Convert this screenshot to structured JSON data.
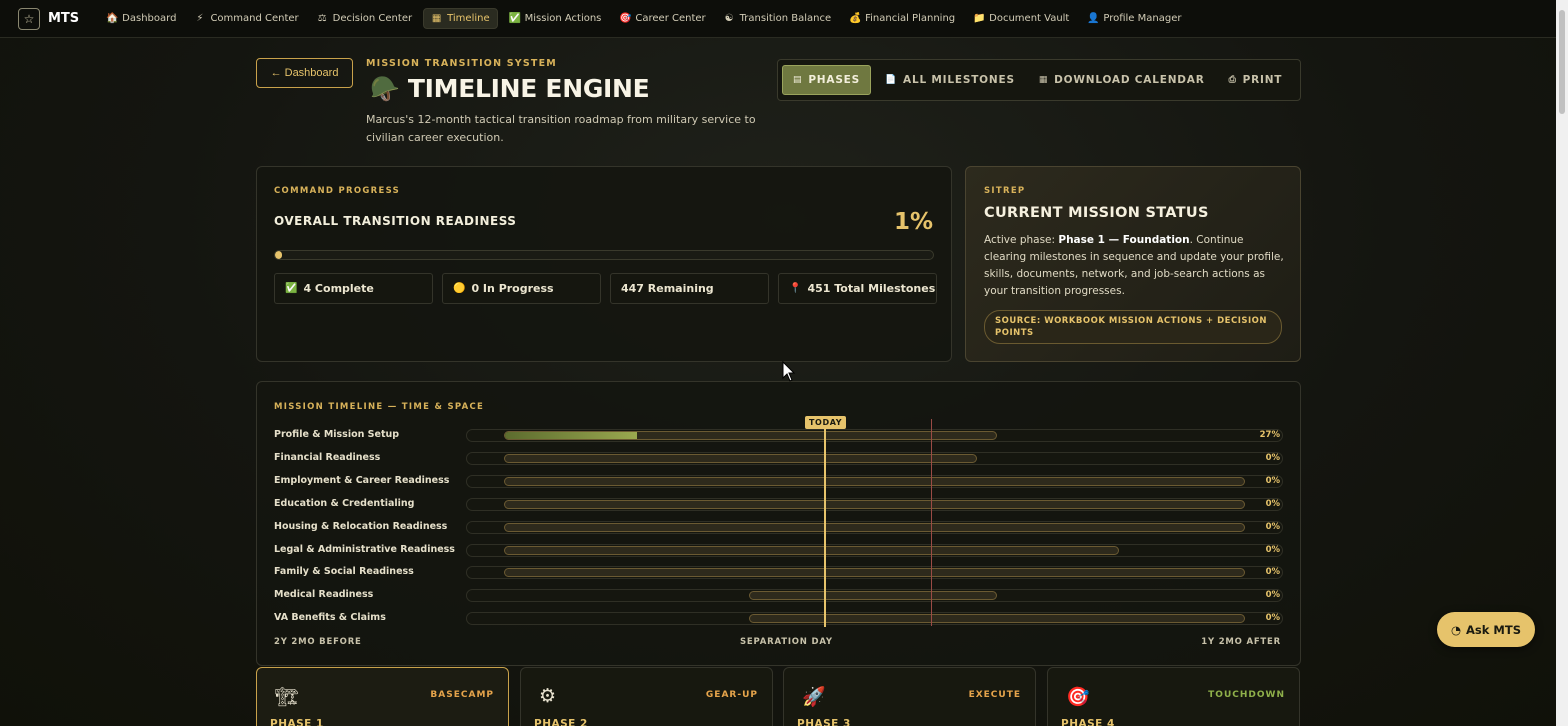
{
  "nav": {
    "logo_icon": "☆",
    "logo_text": "MTS",
    "items": [
      {
        "icon": "🏠",
        "label": "Dashboard",
        "icon_name": "home-icon"
      },
      {
        "icon": "⚡",
        "label": "Command Center",
        "icon_name": "bolt-icon"
      },
      {
        "icon": "⚖",
        "label": "Decision Center",
        "icon_name": "scales-icon"
      },
      {
        "icon": "▦",
        "label": "Timeline",
        "icon_name": "calendar-icon",
        "active": true
      },
      {
        "icon": "✅",
        "label": "Mission Actions",
        "icon_name": "check-icon"
      },
      {
        "icon": "🎯",
        "label": "Career Center",
        "icon_name": "target-icon"
      },
      {
        "icon": "☯",
        "label": "Transition Balance",
        "icon_name": "balance-icon"
      },
      {
        "icon": "💰",
        "label": "Financial Planning",
        "icon_name": "money-bag-icon"
      },
      {
        "icon": "📁",
        "label": "Document Vault",
        "icon_name": "folder-icon"
      },
      {
        "icon": "👤",
        "label": "Profile Manager",
        "icon_name": "user-icon"
      }
    ]
  },
  "header": {
    "back_label": "← Dashboard",
    "eyebrow": "MISSION TRANSITION SYSTEM",
    "title_icon": "🪖",
    "title": "TIMELINE ENGINE",
    "subtitle": "Marcus's 12-month tactical transition roadmap from military service to civilian career execution."
  },
  "view_tabs": [
    {
      "icon": "▤",
      "label": "PHASES",
      "active": true,
      "icon_name": "clipboard-icon"
    },
    {
      "icon": "📄",
      "label": "ALL MILESTONES",
      "icon_name": "document-icon"
    },
    {
      "icon": "▦",
      "label": "DOWNLOAD CALENDAR",
      "icon_name": "calendar-icon"
    },
    {
      "icon": "⎙",
      "label": "PRINT",
      "icon_name": "printer-icon"
    }
  ],
  "progress": {
    "label": "COMMAND PROGRESS",
    "title": "OVERALL TRANSITION READINESS",
    "percent_text": "1%",
    "percent_value": 1,
    "stats": [
      {
        "icon": "✅",
        "text": "4 Complete",
        "icon_name": "check-icon"
      },
      {
        "icon": "🟡",
        "text": "0 In Progress",
        "icon_name": "yellow-dot-icon"
      },
      {
        "icon": "",
        "text": "447 Remaining",
        "icon_name": ""
      },
      {
        "icon": "📍",
        "text": "451 Total Milestones",
        "icon_name": "pin-icon"
      }
    ]
  },
  "sitrep": {
    "label": "SITREP",
    "title": "CURRENT MISSION STATUS",
    "body_prefix": "Active phase: ",
    "body_phase": "Phase 1 — Foundation",
    "body_suffix": ". Continue clearing milestones in sequence and update your profile, skills, documents, network, and job-search actions as your transition progresses.",
    "source": "SOURCE: WORKBOOK MISSION ACTIONS + DECISION POINTS"
  },
  "timeline": {
    "label": "MISSION TIMELINE — TIME & SPACE",
    "today_label": "TODAY",
    "axis_left": "2Y 2MO BEFORE",
    "axis_center": "SEPARATION DAY",
    "axis_right": "1Y 2MO AFTER",
    "rows": [
      {
        "name": "Profile & Mission Setup",
        "pct": "27%",
        "start": 0.046,
        "end": 0.65,
        "progress": 0.27
      },
      {
        "name": "Financial Readiness",
        "pct": "0%",
        "start": 0.046,
        "end": 0.625,
        "progress": 0
      },
      {
        "name": "Employment & Career Readiness",
        "pct": "0%",
        "start": 0.046,
        "end": 0.953,
        "progress": 0
      },
      {
        "name": "Education & Credentialing",
        "pct": "0%",
        "start": 0.046,
        "end": 0.953,
        "progress": 0
      },
      {
        "name": "Housing & Relocation Readiness",
        "pct": "0%",
        "start": 0.046,
        "end": 0.953,
        "progress": 0
      },
      {
        "name": "Legal & Administrative Readiness",
        "pct": "0%",
        "start": 0.046,
        "end": 0.799,
        "progress": 0
      },
      {
        "name": "Family & Social Readiness",
        "pct": "0%",
        "start": 0.046,
        "end": 0.953,
        "progress": 0
      },
      {
        "name": "Medical Readiness",
        "pct": "0%",
        "start": 0.347,
        "end": 0.65,
        "progress": 0
      },
      {
        "name": "VA Benefits & Claims",
        "pct": "0%",
        "start": 0.347,
        "end": 0.953,
        "progress": 0
      }
    ]
  },
  "phases": [
    {
      "icon": "🏗",
      "tag": "BASECAMP",
      "name": "PHASE 1",
      "icon_name": "crane-icon",
      "active": true,
      "green": false
    },
    {
      "icon": "⚙",
      "tag": "GEAR-UP",
      "name": "PHASE 2",
      "icon_name": "gear-icon",
      "active": false,
      "green": false
    },
    {
      "icon": "🚀",
      "tag": "EXECUTE",
      "name": "PHASE 3",
      "icon_name": "rocket-icon",
      "active": false,
      "green": false
    },
    {
      "icon": "🎯",
      "tag": "TOUCHDOWN",
      "name": "PHASE 4",
      "icon_name": "target-icon",
      "active": false,
      "green": true
    }
  ],
  "ask": {
    "icon": "◔",
    "label": "Ask MTS"
  }
}
